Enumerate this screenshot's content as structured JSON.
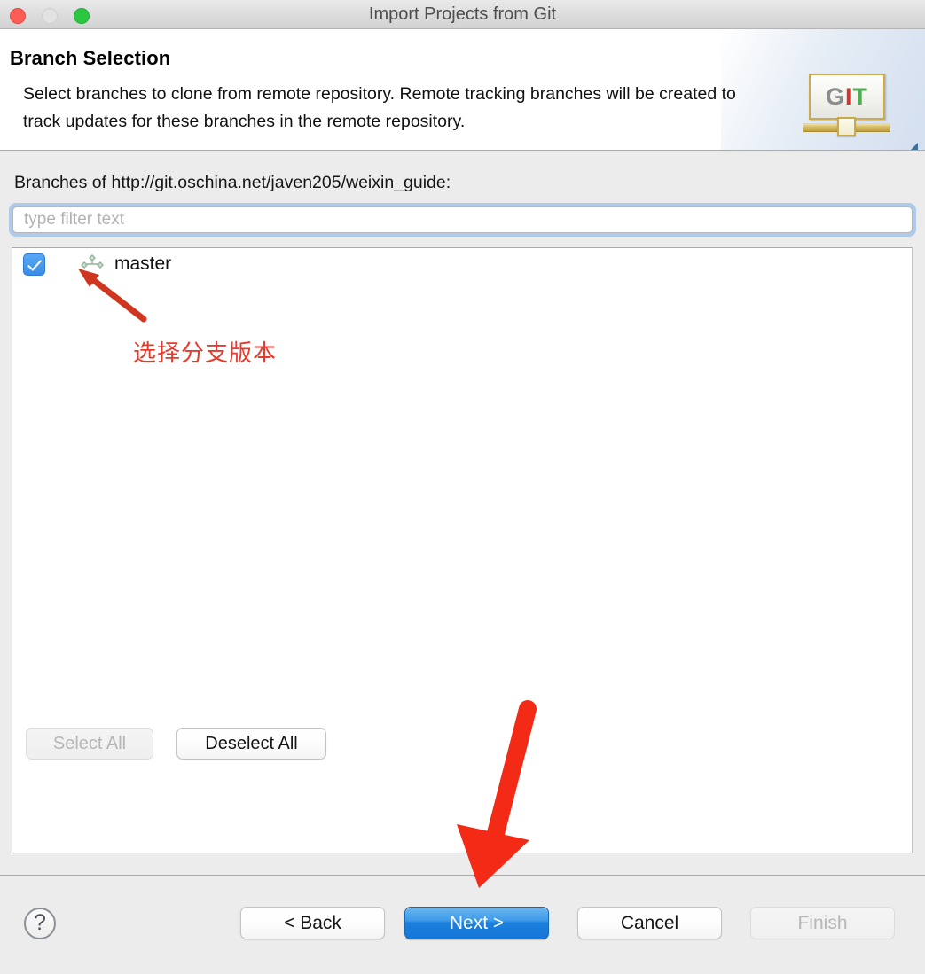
{
  "window": {
    "title": "Import Projects from Git",
    "traffic_lights": [
      {
        "name": "close",
        "color": "#fc5d55"
      },
      {
        "name": "minimize",
        "color": "#e2e2e2"
      },
      {
        "name": "maximize",
        "color": "#2ac840"
      }
    ]
  },
  "header": {
    "title": "Branch Selection",
    "description": "Select branches to clone from remote repository. Remote tracking branches will be created to track updates for these branches in the remote repository.",
    "logo": {
      "name": "git-logo-icon",
      "letters": {
        "g": "G",
        "i": "I",
        "t": "T"
      },
      "colors": {
        "g": "#8c8c8c",
        "i": "#d8332a",
        "t": "#4fae4f"
      }
    }
  },
  "body": {
    "branches_label": "Branches of http://git.oschina.net/javen205/weixin_guide:",
    "filter": {
      "value": "",
      "placeholder": "type filter text"
    },
    "branches": [
      {
        "label": "master",
        "checked": true,
        "icon": "git-branch-icon"
      }
    ],
    "select_all_label": "Select All",
    "select_all_enabled": false,
    "deselect_all_label": "Deselect All",
    "deselect_all_enabled": true
  },
  "footer": {
    "help_label": "?",
    "back_label": "< Back",
    "next_label": "Next >",
    "cancel_label": "Cancel",
    "finish_label": "Finish",
    "next_is_default": true,
    "finish_enabled": false
  },
  "annotations": {
    "branch_note": "选择分支版本",
    "note_color": "#e8392a",
    "arrow_color": "#f32a16",
    "small_arrow_color": "#d0351f"
  }
}
